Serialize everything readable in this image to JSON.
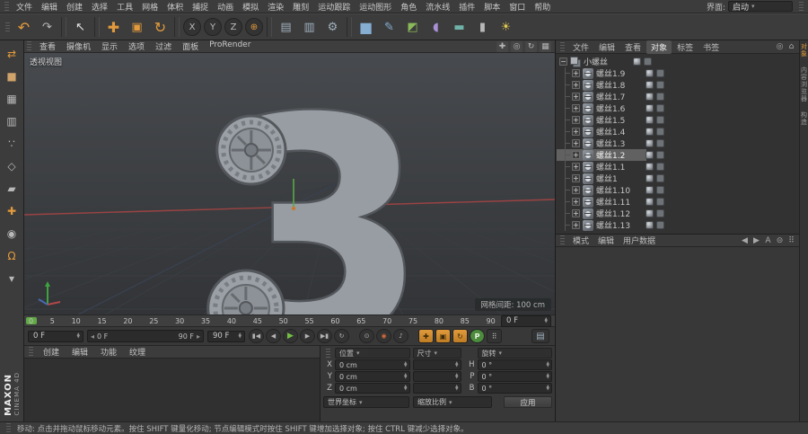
{
  "menubar": {
    "items": [
      "文件",
      "编辑",
      "创建",
      "选择",
      "工具",
      "网格",
      "体积",
      "捕捉",
      "动画",
      "模拟",
      "渲染",
      "雕刻",
      "运动跟踪",
      "运动图形",
      "角色",
      "流水线",
      "插件",
      "脚本",
      "窗口",
      "帮助"
    ],
    "interface_label": "界面:",
    "interface_value": "启动"
  },
  "toolbar": {
    "icons": [
      {
        "name": "undo-button",
        "glyph": "↶",
        "cls": "c-orange big"
      },
      {
        "name": "redo-button",
        "glyph": "↷",
        "cls": "c-gray"
      },
      {
        "name": "toolbar-separator",
        "glyph": "",
        "cls": "sep"
      },
      {
        "name": "live-selection-tool",
        "glyph": "↖",
        "cls": "c-white"
      },
      {
        "name": "toolbar-separator",
        "glyph": "",
        "cls": "sep"
      },
      {
        "name": "move-tool",
        "glyph": "✚",
        "cls": "c-orange big"
      },
      {
        "name": "scale-tool",
        "glyph": "▣",
        "cls": "c-orange"
      },
      {
        "name": "rotate-tool",
        "glyph": "↻",
        "cls": "c-orange big"
      },
      {
        "name": "toolbar-separator",
        "glyph": "",
        "cls": "sep"
      },
      {
        "name": "lock-x-axis-button",
        "glyph": "X",
        "cls": "round"
      },
      {
        "name": "lock-y-axis-button",
        "glyph": "Y",
        "cls": "round"
      },
      {
        "name": "lock-z-axis-button",
        "glyph": "Z",
        "cls": "round"
      },
      {
        "name": "coordinate-system-button",
        "glyph": "⊕",
        "cls": "round c-orange"
      },
      {
        "name": "toolbar-separator",
        "glyph": "",
        "cls": "sep"
      },
      {
        "name": "render-view-button",
        "glyph": "▤",
        "cls": "c-steel"
      },
      {
        "name": "render-picture-viewer-button",
        "glyph": "▥",
        "cls": "c-steel"
      },
      {
        "name": "render-settings-button",
        "glyph": "⚙",
        "cls": "c-steel"
      },
      {
        "name": "toolbar-separator",
        "glyph": "",
        "cls": "sep"
      },
      {
        "name": "add-cube-button",
        "glyph": "■",
        "cls": "c-blue big"
      },
      {
        "name": "add-spline-button",
        "glyph": "✎",
        "cls": "c-blue"
      },
      {
        "name": "add-subdivision-button",
        "glyph": "◩",
        "cls": "c-green"
      },
      {
        "name": "add-deformer-button",
        "glyph": "◖",
        "cls": "c-purple"
      },
      {
        "name": "add-floor-button",
        "glyph": "▬",
        "cls": "c-teal"
      },
      {
        "name": "add-camera-button",
        "glyph": "▮",
        "cls": "c-gray"
      },
      {
        "name": "add-light-button",
        "glyph": "☀",
        "cls": "c-yellow"
      }
    ]
  },
  "left_toolbar": {
    "icons": [
      {
        "name": "make-editable-button",
        "glyph": "⇄",
        "cls": "c-orange"
      },
      {
        "name": "model-mode-button",
        "glyph": "■",
        "cls": "c-tan"
      },
      {
        "name": "texture-mode-button",
        "glyph": "▦",
        "cls": "c-gray"
      },
      {
        "name": "workplane-mode-button",
        "glyph": "▥",
        "cls": "c-gray"
      },
      {
        "name": "points-mode-button",
        "glyph": "∵",
        "cls": "c-gray"
      },
      {
        "name": "edges-mode-button",
        "glyph": "◇",
        "cls": "c-gray"
      },
      {
        "name": "polygons-mode-button",
        "glyph": "▰",
        "cls": "c-gray"
      },
      {
        "name": "enable-axis-button",
        "glyph": "✚",
        "cls": "c-orange"
      },
      {
        "name": "solo-mode-button",
        "glyph": "◉",
        "cls": "c-gray"
      },
      {
        "name": "enable-snap-button",
        "glyph": "Ω",
        "cls": "c-orange"
      },
      {
        "name": "snap-settings-button",
        "glyph": "▾",
        "cls": "c-gray"
      }
    ]
  },
  "viewport": {
    "menu": [
      "查看",
      "摄像机",
      "显示",
      "选项",
      "过滤",
      "面板",
      "ProRender"
    ],
    "nav_icons": [
      {
        "name": "pan-view-icon",
        "glyph": "✚"
      },
      {
        "name": "zoom-view-icon",
        "glyph": "◎"
      },
      {
        "name": "rotate-view-icon",
        "glyph": "↻"
      },
      {
        "name": "toggle-views-icon",
        "glyph": "▦"
      }
    ],
    "view_label": "透视视图",
    "grid_spacing": "网格间距: 100 cm",
    "model_text": "3"
  },
  "timeline": {
    "ticks": [
      "0",
      "5",
      "10",
      "15",
      "20",
      "25",
      "30",
      "35",
      "40",
      "45",
      "50",
      "55",
      "60",
      "65",
      "70",
      "75",
      "80",
      "85",
      "90"
    ],
    "current_frame_field": "0 F",
    "start_field": "0 F",
    "range_start_label": "0 F",
    "range_end_label": "90 F",
    "end_field": "90 F"
  },
  "transport": {
    "buttons": [
      {
        "name": "goto-start-button",
        "glyph": "▮◀"
      },
      {
        "name": "previous-frame-button",
        "glyph": "◀"
      },
      {
        "name": "play-forward-button",
        "glyph": "▶",
        "cls": "play"
      },
      {
        "name": "next-frame-button",
        "glyph": "▶"
      },
      {
        "name": "goto-end-button",
        "glyph": "▶▮"
      },
      {
        "name": "loop-mode-button",
        "glyph": "↻"
      },
      {
        "name": "record-keyframe-button",
        "glyph": "⊙",
        "cls": "gap"
      },
      {
        "name": "autokey-button",
        "glyph": "◉",
        "cls": "red"
      },
      {
        "name": "play-sound-button",
        "glyph": "♪"
      },
      {
        "name": "keyframe-position-toggle",
        "glyph": "✚",
        "cls": "gap osq"
      },
      {
        "name": "keyframe-scale-toggle",
        "glyph": "▣",
        "cls": "osq"
      },
      {
        "name": "keyframe-rotation-toggle",
        "glyph": "↻",
        "cls": "osq"
      },
      {
        "name": "keyframe-parameter-toggle",
        "glyph": "P",
        "cls": "pgreen"
      },
      {
        "name": "keyframe-pla-toggle",
        "glyph": "⠿",
        "cls": "sq"
      },
      {
        "name": "timeline-window-button",
        "glyph": "▤",
        "cls": "endbtn"
      }
    ]
  },
  "materials": {
    "tabs": [
      "创建",
      "编辑",
      "功能",
      "纹理"
    ]
  },
  "coordinates": {
    "headers": [
      "位置",
      "尺寸",
      "旋转"
    ],
    "rows": [
      {
        "axis": "X",
        "pos": "0 cm",
        "size": "",
        "rot_axis": "H",
        "rot": "0 °"
      },
      {
        "axis": "Y",
        "pos": "0 cm",
        "size": "",
        "rot_axis": "P",
        "rot": "0 °"
      },
      {
        "axis": "Z",
        "pos": "0 cm",
        "size": "",
        "rot_axis": "B",
        "rot": "0 °"
      }
    ],
    "coord_system": "世界坐标",
    "size_mode": "缩放比例",
    "apply_label": "应用"
  },
  "object_manager": {
    "tabs": [
      {
        "label": "文件"
      },
      {
        "label": "编辑"
      },
      {
        "label": "查看"
      },
      {
        "label": "对象",
        "cls": "active"
      },
      {
        "label": "标签"
      },
      {
        "label": "书签"
      }
    ],
    "header_icons": [
      {
        "name": "filter-icon",
        "glyph": "◎"
      },
      {
        "name": "home-icon",
        "glyph": "⌂"
      }
    ],
    "objects": [
      {
        "name": "object-row",
        "label": "小螺丝",
        "expander": "−",
        "cls": "parent"
      },
      {
        "name": "object-row",
        "label": "螺丝1.9",
        "expander": "+",
        "cls": "child"
      },
      {
        "name": "object-row",
        "label": "螺丝1.8",
        "expander": "+",
        "cls": "child"
      },
      {
        "name": "object-row",
        "label": "螺丝1.7",
        "expander": "+",
        "cls": "child"
      },
      {
        "name": "object-row",
        "label": "螺丝1.6",
        "expander": "+",
        "cls": "child"
      },
      {
        "name": "object-row",
        "label": "螺丝1.5",
        "expander": "+",
        "cls": "child"
      },
      {
        "name": "object-row",
        "label": "螺丝1.4",
        "expander": "+",
        "cls": "child"
      },
      {
        "name": "object-row",
        "label": "螺丝1.3",
        "expander": "+",
        "cls": "child"
      },
      {
        "name": "object-row",
        "label": "螺丝1.2",
        "expander": "+",
        "cls": "child selected"
      },
      {
        "name": "object-row",
        "label": "螺丝1.1",
        "expander": "+",
        "cls": "child"
      },
      {
        "name": "object-row",
        "label": "螺丝1",
        "expander": "+",
        "cls": "child"
      },
      {
        "name": "object-row",
        "label": "螺丝1.10",
        "expander": "+",
        "cls": "child"
      },
      {
        "name": "object-row",
        "label": "螺丝1.11",
        "expander": "+",
        "cls": "child"
      },
      {
        "name": "object-row",
        "label": "螺丝1.12",
        "expander": "+",
        "cls": "child"
      },
      {
        "name": "object-row",
        "label": "螺丝1.13",
        "expander": "+",
        "cls": "child"
      }
    ]
  },
  "attribute_manager": {
    "tabs": [
      "模式",
      "编辑",
      "用户数据"
    ],
    "icons": [
      {
        "name": "back-icon",
        "glyph": "◀"
      },
      {
        "name": "forward-icon",
        "glyph": "▶"
      },
      {
        "name": "a-mode-icon",
        "glyph": "A"
      },
      {
        "name": "lock-icon",
        "glyph": "⊝"
      },
      {
        "name": "grid-icon",
        "glyph": "⠿"
      }
    ]
  },
  "right_strip": {
    "tabs": [
      {
        "label": "对象",
        "cls": "active"
      },
      {
        "label": "内容浏览器"
      },
      {
        "label": "构造"
      }
    ]
  },
  "logo": {
    "maxon": "MAXON",
    "cinema": "CINEMA 4D"
  },
  "statusbar": {
    "text": "移动: 点击并拖动鼠标移动元素。按住 SHIFT 键量化移动; 节点编辑模式时按住 SHIFT 键增加选择对象; 按住 CTRL 键减少选择对象。"
  }
}
